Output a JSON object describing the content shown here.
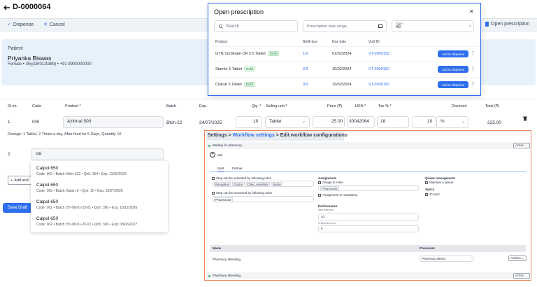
{
  "header": {
    "back_icon": "arrow-left-icon",
    "title": "D-0000064"
  },
  "toolbar": {
    "dispense_label": "Dispense",
    "cancel_label": "Cancel",
    "open_prescription_label": "Open prescription"
  },
  "patient": {
    "section_label": "Patient",
    "name": "Priyanka Biswas",
    "details": "Female • 35y(18/01/1989) • +91 9900000000"
  },
  "table": {
    "headers": [
      "Sl no.",
      "Code",
      "Product *",
      "Batch",
      "Exp.",
      "Qty. *",
      "Selling unit *",
      "Price (₹)",
      "HSN *",
      "Tax % *",
      "Discount",
      "Total (₹)"
    ],
    "row1": {
      "sl": "1.",
      "code": "005",
      "product": "Azithral 500",
      "batch": "Btch-22",
      "exp": "24/07/2025",
      "qty": "10",
      "unit": "Tablet",
      "price": "25.00",
      "hsn": "30042064",
      "tax": "18",
      "discount": "10",
      "discount_type": "%",
      "total": "225.00"
    },
    "dosage": "Dosage: 1 Tablet, 2 Times a day, After food for 5 Days, Quantity 10",
    "row2": {
      "sl": "2.",
      "product_query": "cal"
    },
    "add_label": "Add and",
    "save_label": "Save Draft"
  },
  "suggestions": [
    {
      "name": "Calpol 650",
      "meta": "Code: 002 • Batch: Btch-223 • Qoh: 354 • Exp: 11/02/2025"
    },
    {
      "name": "Calpol 650",
      "meta": "Code: 002 • Batch: Batch-3 • Qoh: 10 • Exp: 16/07/2025"
    },
    {
      "name": "Calpol 650",
      "meta": "Code: 002 • Batch: BT-08-01-23-01 • Qoh: 300 • Exp: 10/12/2026"
    },
    {
      "name": "Calpol 650",
      "meta": "Code: 002 • Batch: BT-08-01-23-02 • Qoh: 300 • Exp: 08/06/2027"
    }
  ],
  "modal": {
    "title": "Open prescription",
    "search_placeholder": "Search",
    "date_placeholder": "Prescription date range",
    "type_label": "Type",
    "type_value": "All",
    "columns": [
      "Product",
      "Refill due",
      "Due date",
      "Visit ID"
    ],
    "rows": [
      {
        "product": "GTN Sorbitrate CR 2.6 Tablet",
        "badge": "Refill",
        "refill": "1/2",
        "due": "01/02/2024",
        "visit": "VT-0000152",
        "action": "Add to dispense"
      },
      {
        "product": "Starnio 5 Tablet",
        "badge": "Refill",
        "refill": "2/3",
        "due": "16/02/2024",
        "visit": "VT-0000152",
        "action": "Add to dispense"
      },
      {
        "product": "Cilacar 5 Tablet",
        "badge": "Refill",
        "refill": "0/2",
        "due": "19/02/2024",
        "visit": "VT-0000152",
        "action": "Add to dispense"
      }
    ]
  },
  "workflow": {
    "breadcrumb_settings": "Settings >",
    "breadcrumb_workflow": "Workflow settings",
    "breadcrumb_current": "> Edit workflow configurations",
    "stage1": "Waiting for pharmacy",
    "action_label": "Action",
    "add_label": "Add",
    "tab_start": "Start",
    "tab_partner": "Partner",
    "activated_label": "Step can be activated by following roles",
    "activated_roles": [
      "Reception",
      "Doctor",
      "Clinic Assistant",
      "Nurse"
    ],
    "accessed_label": "Step can be accessed by following roles",
    "accessed_roles": [
      "Pharmacist"
    ],
    "assignment_title": "Assignment",
    "assign_roles_label": "Assign to roles",
    "assign_roles": [
      "Pharmacist"
    ],
    "assignment_mandatory": "Assignment is mandatory",
    "queue_title": "Queue management",
    "queue_option": "Maintain a queue",
    "sync_title": "Syncs",
    "sync_option": "To sync",
    "performance_title": "Performance",
    "wait_label": "Wait time(min)",
    "wait_value": "10",
    "critical_label": "Critical time(min)",
    "critical_value": "5",
    "name_header": "Name",
    "processor_header": "Processor",
    "proc_name": "Pharmacy attending",
    "proc_value": "Pharmacy attend",
    "proc_action": "Actions",
    "stage2": "Pharmacy attending",
    "stage2_action": "Action"
  }
}
